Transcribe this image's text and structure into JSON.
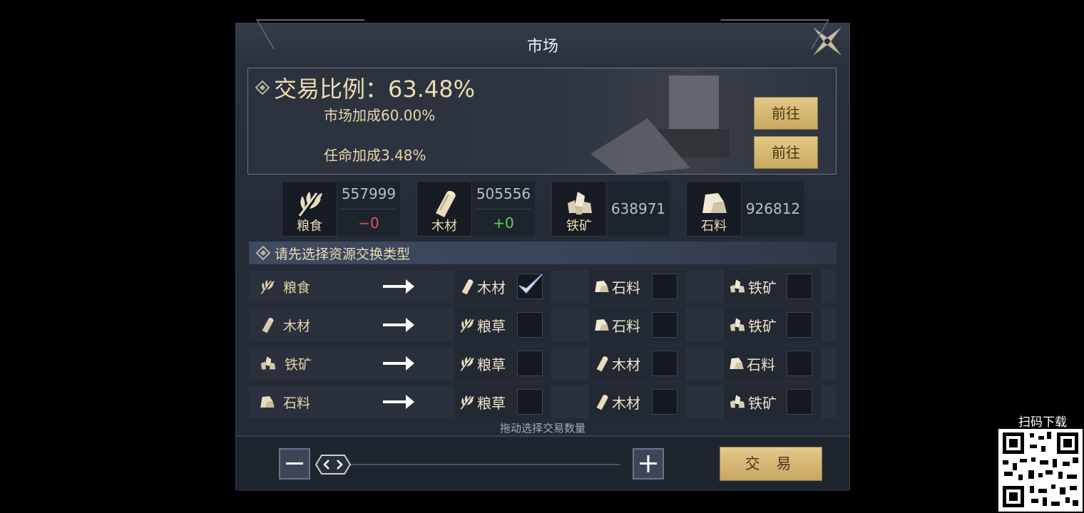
{
  "title": "市场",
  "ratio": {
    "heading": "交易比例：63.48%",
    "market_bonus": "市场加成60.00%",
    "appoint_bonus": "任命加成3.48%",
    "goto_label": "前往"
  },
  "resources": [
    {
      "name": "粮食",
      "amount": "557999",
      "delta": "−0",
      "delta_color": "#e0505a"
    },
    {
      "name": "木材",
      "amount": "505556",
      "delta": "+0",
      "delta_color": "#5cd05c"
    },
    {
      "name": "铁矿",
      "amount": "638971"
    },
    {
      "name": "石料",
      "amount": "926812"
    }
  ],
  "section_title": "请先选择资源交换类型",
  "exchange_rows": [
    {
      "source": "粮食",
      "options": [
        {
          "label": "木材",
          "checked": true
        },
        {
          "label": "石料",
          "checked": false
        },
        {
          "label": "铁矿",
          "checked": false
        }
      ]
    },
    {
      "source": "木材",
      "options": [
        {
          "label": "粮草",
          "checked": false
        },
        {
          "label": "石料",
          "checked": false
        },
        {
          "label": "铁矿",
          "checked": false
        }
      ]
    },
    {
      "source": "铁矿",
      "options": [
        {
          "label": "粮草",
          "checked": false
        },
        {
          "label": "木材",
          "checked": false
        },
        {
          "label": "石料",
          "checked": false
        }
      ]
    },
    {
      "source": "石料",
      "options": [
        {
          "label": "粮草",
          "checked": false
        },
        {
          "label": "木材",
          "checked": false
        },
        {
          "label": "铁矿",
          "checked": false
        }
      ]
    }
  ],
  "drag_hint": "拖动选择交易数量",
  "trade_label": "交 易",
  "qr_label": "扫码下载",
  "colors": {
    "gold": "#ecdcb0",
    "button_gold": "#d8bb73"
  }
}
